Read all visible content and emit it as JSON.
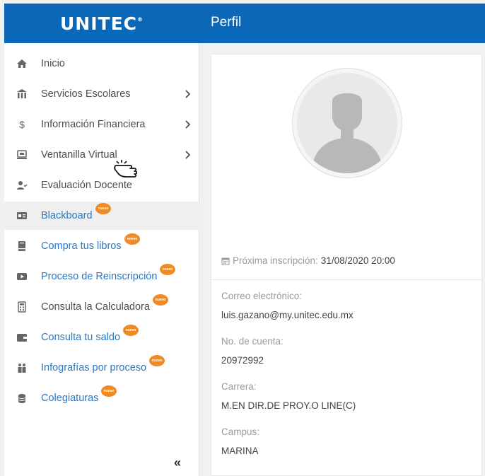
{
  "brand": {
    "name": "UNITEC",
    "mark": "®"
  },
  "header": {
    "title": "Perfil"
  },
  "sidebar": {
    "items": [
      {
        "label": "Inicio",
        "icon": "home-icon"
      },
      {
        "label": "Servicios Escolares",
        "icon": "school-icon"
      },
      {
        "label": "Información Financiera",
        "icon": "dollar-icon"
      },
      {
        "label": "Ventanilla Virtual",
        "icon": "monitor-icon"
      },
      {
        "label": "Evaluación Docente",
        "icon": "user-check-icon"
      },
      {
        "label": "Blackboard",
        "icon": "id-card-icon",
        "badge": "nuevo"
      },
      {
        "label": "Compra tus libros",
        "icon": "book-icon",
        "badge": "nuevo"
      },
      {
        "label": "Proceso de Reinscripción",
        "icon": "play-icon",
        "badge": "nuevo"
      },
      {
        "label": "Consulta la Calculadora",
        "icon": "calculator-icon",
        "badge": "nuevo"
      },
      {
        "label": "Consulta tu saldo",
        "icon": "wallet-icon",
        "badge": "nuevo"
      },
      {
        "label": "Infografías por proceso",
        "icon": "people-icon",
        "badge": "nuevo"
      },
      {
        "label": "Colegiaturas",
        "icon": "coins-icon",
        "badge": "nuevo"
      }
    ],
    "collapse_label": "«"
  },
  "profile": {
    "next_enrollment_label": "Próxima inscripción:",
    "next_enrollment_value": "31/08/2020 20:00",
    "fields": [
      {
        "label": "Correo electrónico:",
        "value": "luis.gazano@my.unitec.edu.mx"
      },
      {
        "label": "No. de cuenta:",
        "value": "20972992"
      },
      {
        "label": "Carrera:",
        "value": "M.EN DIR.DE PROY.O LINE(C)"
      },
      {
        "label": "Campus:",
        "value": "MARINA"
      }
    ]
  },
  "colors": {
    "primary": "#0b67b8",
    "badge": "#f08a24",
    "link": "#2a78c2"
  }
}
